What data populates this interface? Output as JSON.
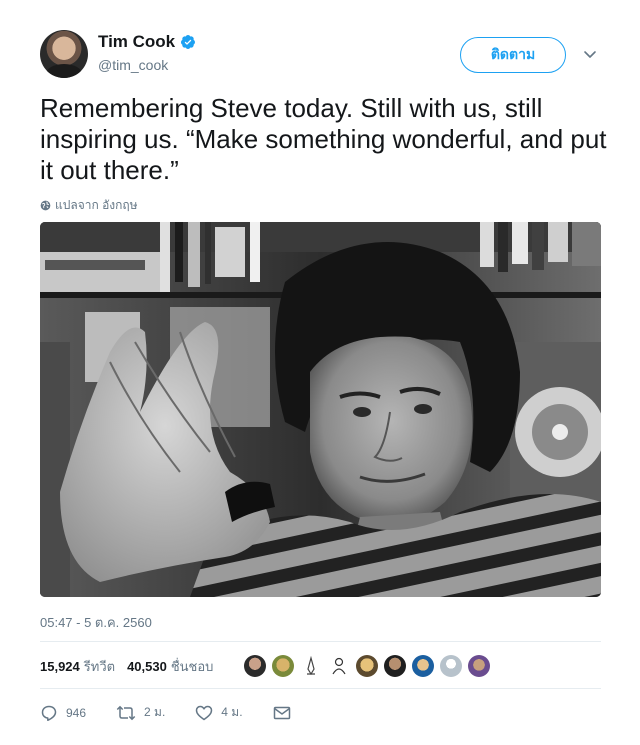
{
  "header": {
    "name": "Tim Cook",
    "handle": "@tim_cook",
    "follow_label": "ติดตาม",
    "verified_icon": "verified-badge-icon",
    "menu_icon": "chevron-down-icon"
  },
  "tweet": {
    "text": "Remembering Steve today. Still with us, still inspiring us. “Make something wonderful, and put it out there.”",
    "translate_label": "แปลจาก อังกฤษ",
    "timestamp": "05:47 - 5 ต.ค. 2560"
  },
  "stats": {
    "retweets_count": "15,924",
    "retweets_label": "รีทวีต",
    "likes_count": "40,530",
    "likes_label": "ชื่นชอบ"
  },
  "actions": {
    "reply_count": "946",
    "retweet_count": "2 ม.",
    "like_count": "4 ม."
  },
  "colors": {
    "accent": "#1da1f2",
    "secondary_text": "#657786",
    "primary_text": "#14171a",
    "divider": "#e6ecf0"
  }
}
